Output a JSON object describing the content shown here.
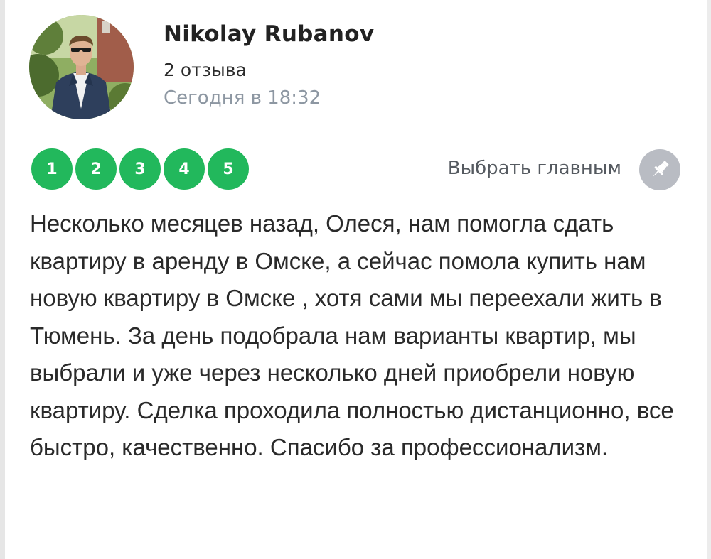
{
  "review": {
    "author": "Nikolay Rubanov",
    "review_count": "2 отзыва",
    "date": "Сегодня в 18:32",
    "rating": {
      "options": [
        "1",
        "2",
        "3",
        "4",
        "5"
      ],
      "selected": 5,
      "max": 5,
      "color": "#22b85c"
    },
    "pin_label": "Выбрать главным",
    "pin_icon": "pin-icon",
    "text": "Несколько месяцев назад, Олеся, нам помогла сдать квартиру в аренду в Омске, а сейчас помола купить нам новую квартиру в Омске , хотя сами мы переехали жить в Тюмень. За день подобрала нам варианты квартир, мы выбрали и уже через несколько дней приобрели новую квартиру. Сделка проходила полностью дистанционно, все быстро, качественно. Спасибо за профессионализм."
  },
  "colors": {
    "accent_green": "#22b85c",
    "muted_text": "#8d97a2",
    "pin_button": "#b9bcc3"
  }
}
